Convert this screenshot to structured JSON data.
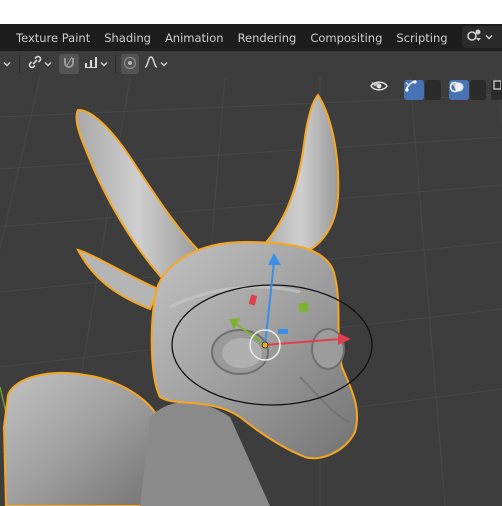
{
  "workspace_tabs": [
    {
      "label": "Texture Paint"
    },
    {
      "label": "Shading"
    },
    {
      "label": "Animation"
    },
    {
      "label": "Rendering"
    },
    {
      "label": "Compositing"
    },
    {
      "label": "Scripting"
    }
  ],
  "add_tab_label": "+",
  "toolbar": {
    "icons": [
      "chevron-down-icon",
      "link-icon",
      "snap-magnet-icon",
      "snap-increment-icon",
      "proportional-edit-icon",
      "falloff-curve-icon"
    ]
  },
  "viewport_overlay": {
    "icons": [
      "visibility-eye-icon",
      "gizmo-toggle-icon",
      "overlay-toggle-icon"
    ]
  },
  "colors": {
    "header_bg": "#1d1d1d",
    "toolbar_bg": "#3d3d3d",
    "viewport_bg": "#3d3d3d",
    "selection_outline": "#f5a623",
    "gizmo_x": "#e0404d",
    "gizmo_y": "#7bb32e",
    "gizmo_z": "#3a8ee6",
    "overlay_active": "#4772b3"
  }
}
